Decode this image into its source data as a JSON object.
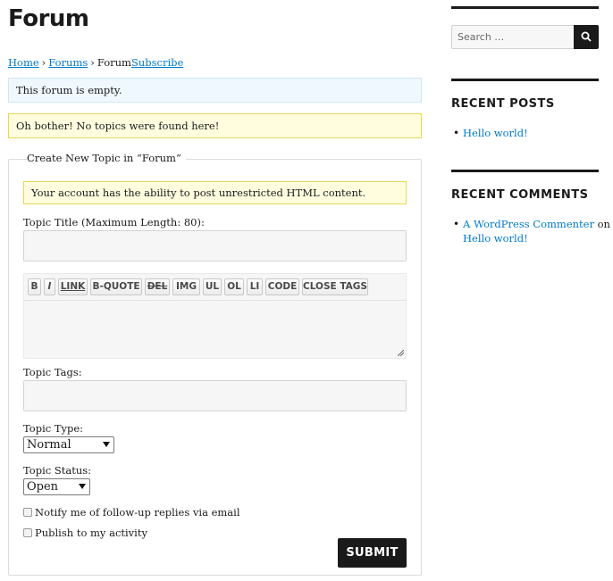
{
  "page": {
    "title": "Forum"
  },
  "breadcrumb": {
    "home": "Home",
    "forums": "Forums",
    "current": "Forum",
    "subscribe": "Subscribe",
    "separator": "›"
  },
  "notices": {
    "empty": "This forum is empty.",
    "no_topics": "Oh bother! No topics were found here!"
  },
  "form": {
    "legend": "Create New Topic in “Forum”",
    "html_notice": "Your account has the ability to post unrestricted HTML content.",
    "title_label": "Topic Title (Maximum Length: 80):",
    "toolbar": [
      "B",
      "I",
      "LINK",
      "B-QUOTE",
      "DEL",
      "IMG",
      "UL",
      "OL",
      "LI",
      "CODE",
      "CLOSE TAGS"
    ],
    "tags_label": "Topic Tags:",
    "type_label": "Topic Type:",
    "type_value": "Normal",
    "status_label": "Topic Status:",
    "status_value": "Open",
    "notify_label": "Notify me of follow-up replies via email",
    "publish_label": "Publish to my activity",
    "submit_label": "SUBMIT"
  },
  "sidebar": {
    "search_placeholder": "Search …",
    "recent_posts": {
      "title": "RECENT POSTS",
      "items": [
        "Hello world!"
      ]
    },
    "recent_comments": {
      "title": "RECENT COMMENTS",
      "items": [
        {
          "author": "A WordPress Commenter",
          "on": "on",
          "post": "Hello world!"
        }
      ]
    }
  },
  "colors": {
    "link": "#007acc",
    "dark": "#1a1a1a",
    "info_bg": "#f0f8ff",
    "warn_bg": "#fffdde"
  },
  "icons": {
    "search_button": "search-icon",
    "textarea_resize": "resize-grip-icon"
  }
}
